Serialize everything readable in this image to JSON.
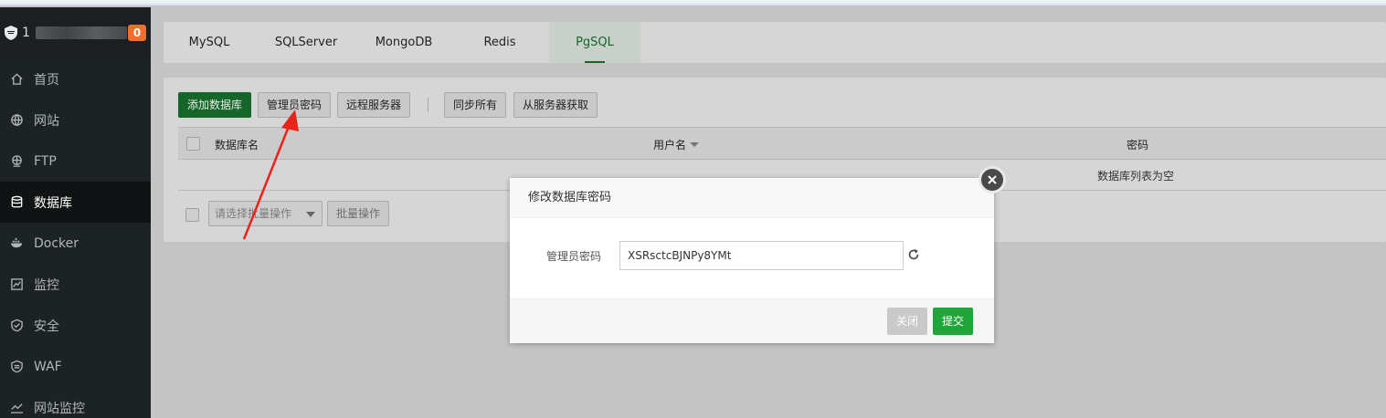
{
  "sidebar": {
    "title": "1",
    "badge": "0",
    "items": [
      {
        "label": "首页",
        "icon": "home-icon"
      },
      {
        "label": "网站",
        "icon": "globe-icon"
      },
      {
        "label": "FTP",
        "icon": "globe-network-icon"
      },
      {
        "label": "数据库",
        "icon": "database-icon",
        "active": true
      },
      {
        "label": "Docker",
        "icon": "docker-whale-icon"
      },
      {
        "label": "监控",
        "icon": "monitor-chart-icon"
      },
      {
        "label": "安全",
        "icon": "shield-check-icon"
      },
      {
        "label": "WAF",
        "icon": "waf-shield-icon"
      },
      {
        "label": "网站监控",
        "icon": "line-chart-icon"
      }
    ]
  },
  "tabs": [
    {
      "label": "MySQL"
    },
    {
      "label": "SQLServer"
    },
    {
      "label": "MongoDB"
    },
    {
      "label": "Redis"
    },
    {
      "label": "PgSQL",
      "active": true
    }
  ],
  "toolbar": {
    "add_db": "添加数据库",
    "admin_password": "管理员密码",
    "remote_server": "远程服务器",
    "sync_all": "同步所有",
    "fetch_from_server": "从服务器获取"
  },
  "table": {
    "columns": [
      "数据库名",
      "用户名",
      "密码"
    ],
    "empty_text": "数据库列表为空"
  },
  "batch": {
    "select_placeholder": "请选择批量操作",
    "button": "批量操作"
  },
  "modal": {
    "title": "修改数据库密码",
    "field_label": "管理员密码",
    "field_value": "XSRsctcBJNPy8YMt",
    "close_label": "关闭",
    "submit_label": "提交"
  },
  "colors": {
    "accent_green": "#20a53a",
    "badge_orange": "#f0702a",
    "annotation_red": "#e8231a"
  }
}
